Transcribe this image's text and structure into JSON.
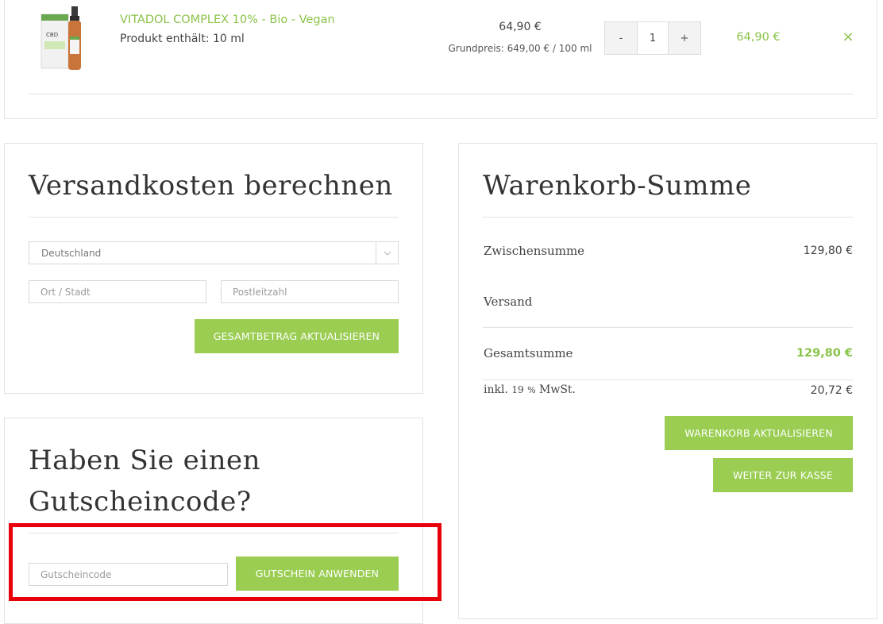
{
  "cart_item": {
    "name": "VITADOL COMPLEX 10% - Bio - Vegan",
    "contains": "Produkt enthält: 10 ml",
    "price": "64,90 €",
    "base_price": "Grundpreis: 649,00 € / 100 ml",
    "qty_minus": "-",
    "qty_value": "1",
    "qty_plus": "+",
    "subtotal": "64,90 €",
    "remove": "×",
    "image_label": "CBD"
  },
  "shipping": {
    "title": "Versandkosten berechnen",
    "country": "Deutschland",
    "city_placeholder": "Ort / Stadt",
    "zip_placeholder": "Postleitzahl",
    "update_button": "GESAMTBETRAG AKTUALISIEREN"
  },
  "coupon": {
    "title_line1": "Haben Sie einen",
    "title_line2": "Gutscheincode?",
    "placeholder": "Gutscheincode",
    "apply_button": "GUTSCHEIN ANWENDEN"
  },
  "totals": {
    "title": "Warenkorb-Summe",
    "subtotal_label": "Zwischensumme",
    "subtotal_value": "129,80 €",
    "shipping_label": "Versand",
    "total_label": "Gesamtsumme",
    "total_value": "129,80 €",
    "tax_label_prefix": "inkl.",
    "tax_rate": "19",
    "tax_percent": "%",
    "tax_label_suffix": "MwSt.",
    "tax_value": "20,72 €",
    "update_cart_button": "WARENKORB AKTUALISIEREN",
    "checkout_button": "WEITER ZUR KASSE"
  },
  "colors": {
    "accent": "#9acd52",
    "highlight_frame": "#e8000b"
  }
}
